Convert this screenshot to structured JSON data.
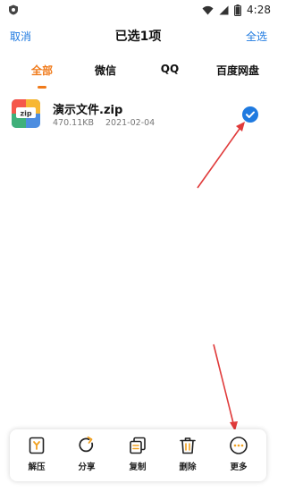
{
  "status_bar": {
    "time": "4:28",
    "icons": [
      "app-shield-icon",
      "wifi-icon",
      "signal-icon",
      "battery-icon"
    ]
  },
  "header": {
    "cancel_label": "取消",
    "title": "已选1项",
    "select_all_label": "全选"
  },
  "tabs": [
    {
      "label": "全部",
      "active": true
    },
    {
      "label": "微信",
      "active": false
    },
    {
      "label": "QQ",
      "active": false
    },
    {
      "label": "百度网盘",
      "active": false
    }
  ],
  "files": [
    {
      "name": "演示文件.zip",
      "icon_label": "zip",
      "size": "470.11KB",
      "date": "2021-02-04",
      "selected": true
    }
  ],
  "actions": [
    {
      "label": "解压",
      "icon": "extract-icon"
    },
    {
      "label": "分享",
      "icon": "share-icon"
    },
    {
      "label": "复制",
      "icon": "copy-icon"
    },
    {
      "label": "删除",
      "icon": "delete-icon"
    },
    {
      "label": "更多",
      "icon": "more-icon"
    }
  ],
  "colors": {
    "accent_blue": "#1f7ae0",
    "tab_active": "#f07a1a",
    "annotation_arrow": "#e03a3a"
  }
}
